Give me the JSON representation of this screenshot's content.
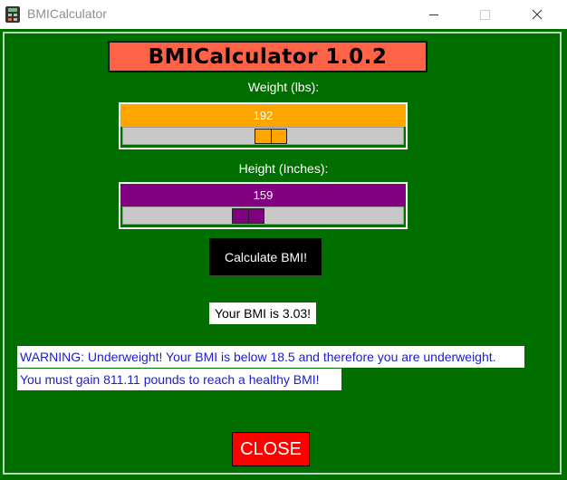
{
  "window": {
    "title": "BMICalculator",
    "icon": "calculator-icon"
  },
  "header": {
    "title": "BMICalculator 1.0.2"
  },
  "weight": {
    "label": "Weight (lbs):",
    "value": "192",
    "color": "#ffa500"
  },
  "height": {
    "label": "Height (Inches):",
    "value": "159",
    "color": "#800080"
  },
  "actions": {
    "calculate_label": "Calculate BMI!",
    "close_label": "CLOSE"
  },
  "result": {
    "bmi_text": "Your BMI is 3.03!",
    "warning_line1": "WARNING: Underweight! Your BMI is below 18.5 and therefore you are underweight.",
    "warning_line2": "You must gain 811.11 pounds to reach a healthy BMI!"
  },
  "colors": {
    "background": "#006f00",
    "header_bg": "#ff6347",
    "close_bg": "#ff0000",
    "warning_text": "#1d1dcc"
  }
}
